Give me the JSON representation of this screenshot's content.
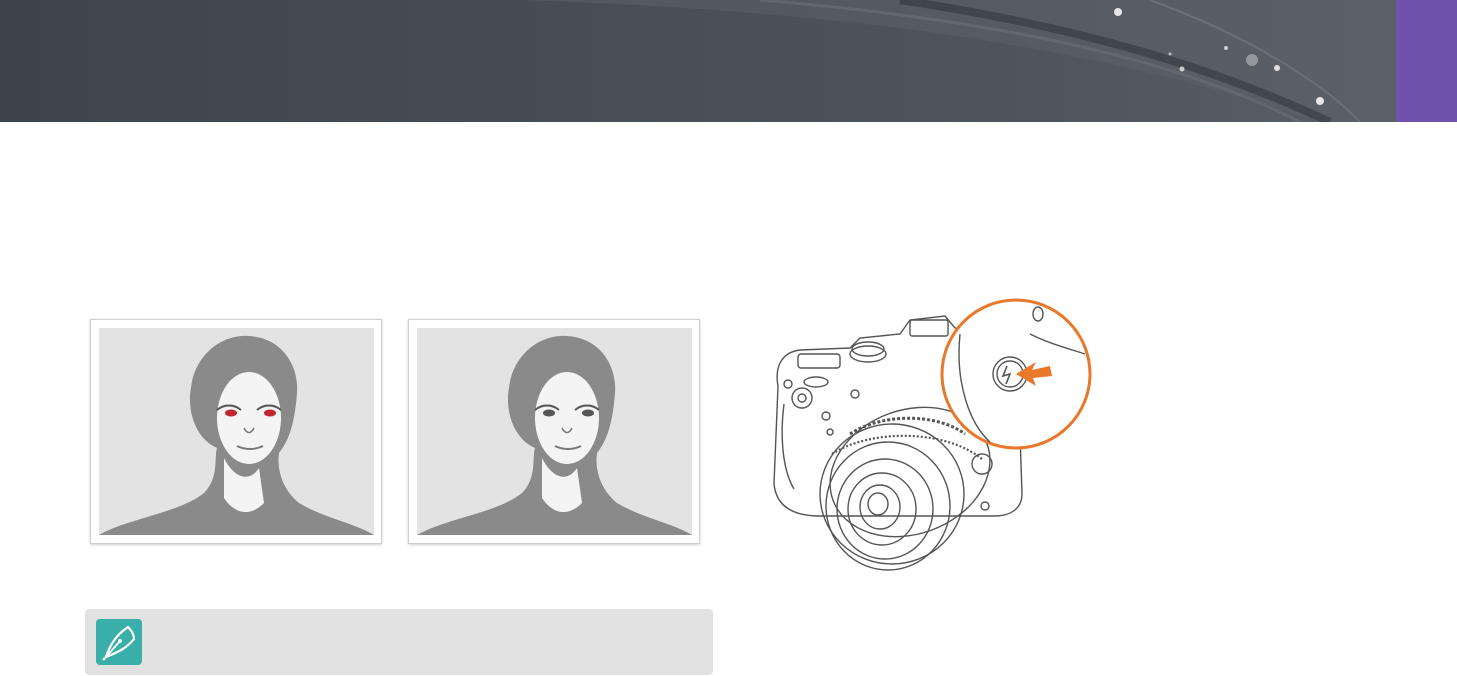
{
  "header": {
    "accent_color": "#6e52ab"
  },
  "figures": [
    {
      "id": "red-eye",
      "eye_color": "#c0262f"
    },
    {
      "id": "red-eye-reduced",
      "eye_color": "#555555"
    }
  ],
  "camera_illustration": {
    "highlight_color": "#e8782a",
    "button_icon": "flash-icon"
  },
  "note": {
    "icon": "pen-nib-icon",
    "icon_color": "#3aafa9",
    "text": ""
  }
}
